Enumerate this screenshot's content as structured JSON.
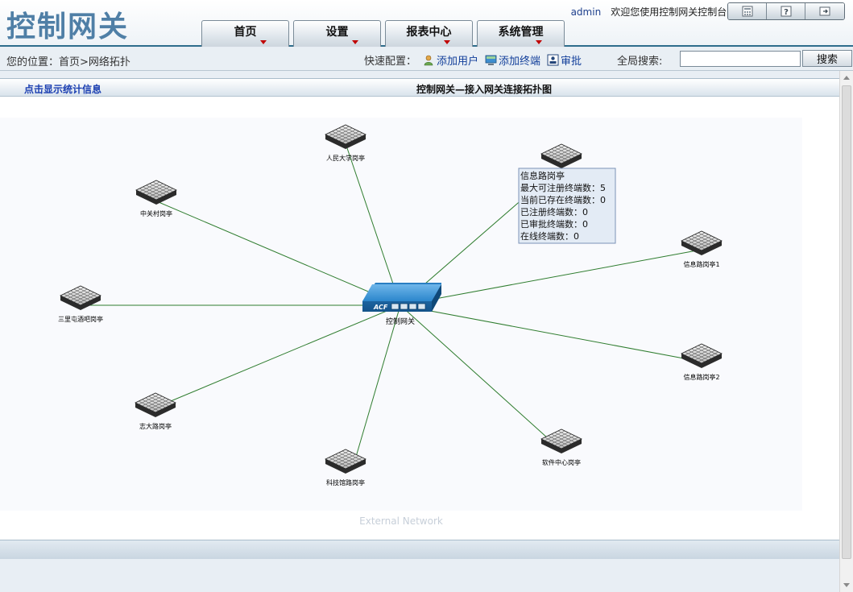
{
  "header": {
    "logo": "控制网关",
    "username": "admin",
    "welcome": "欢迎您使用控制网关控制台!",
    "icons": [
      "calculator-icon",
      "help-icon",
      "logout-icon"
    ]
  },
  "nav": {
    "tabs": [
      {
        "label": "首页"
      },
      {
        "label": "设置"
      },
      {
        "label": "报表中心"
      },
      {
        "label": "系统管理"
      }
    ]
  },
  "breadcrumb": {
    "text": "您的位置：首页>网络拓扑"
  },
  "quick_config": {
    "label": "快速配置：",
    "links": [
      {
        "label": "添加用户",
        "icon": "add-user-icon"
      },
      {
        "label": "添加终端",
        "icon": "add-terminal-icon"
      },
      {
        "label": "审批",
        "icon": "approve-icon"
      }
    ]
  },
  "search": {
    "label": "全局搜索:",
    "value": "",
    "button": "搜索"
  },
  "panel": {
    "stats_link": "点击显示统计信息",
    "title": "控制网关—接入网关连接拓扑图"
  },
  "topology": {
    "center_label": "控制网关",
    "center_badge": "ACF",
    "watermark": "External Network",
    "nodes": [
      {
        "label": "人民大学岗亭"
      },
      {
        "label": "信息路岗亭"
      },
      {
        "label": "中关村岗亭"
      },
      {
        "label": "信息路岗亭1"
      },
      {
        "label": "三里屯酒吧岗亭"
      },
      {
        "label": "信息路岗亭2"
      },
      {
        "label": "志大路岗亭"
      },
      {
        "label": "软件中心岗亭"
      },
      {
        "label": "科技馆路岗亭"
      }
    ],
    "tooltip": {
      "lines": [
        "信息路岗亭",
        "最大可注册终端数：5",
        "当前已存在终端数：0",
        "已注册终端数：0",
        "已审批终端数：0",
        "在线终端数：0"
      ]
    },
    "colors": {
      "link": "#2f7d2f",
      "gateway": "#1a74b8",
      "tooltip_bg": "#e3ebf5",
      "tooltip_border": "#7b93b6"
    }
  }
}
